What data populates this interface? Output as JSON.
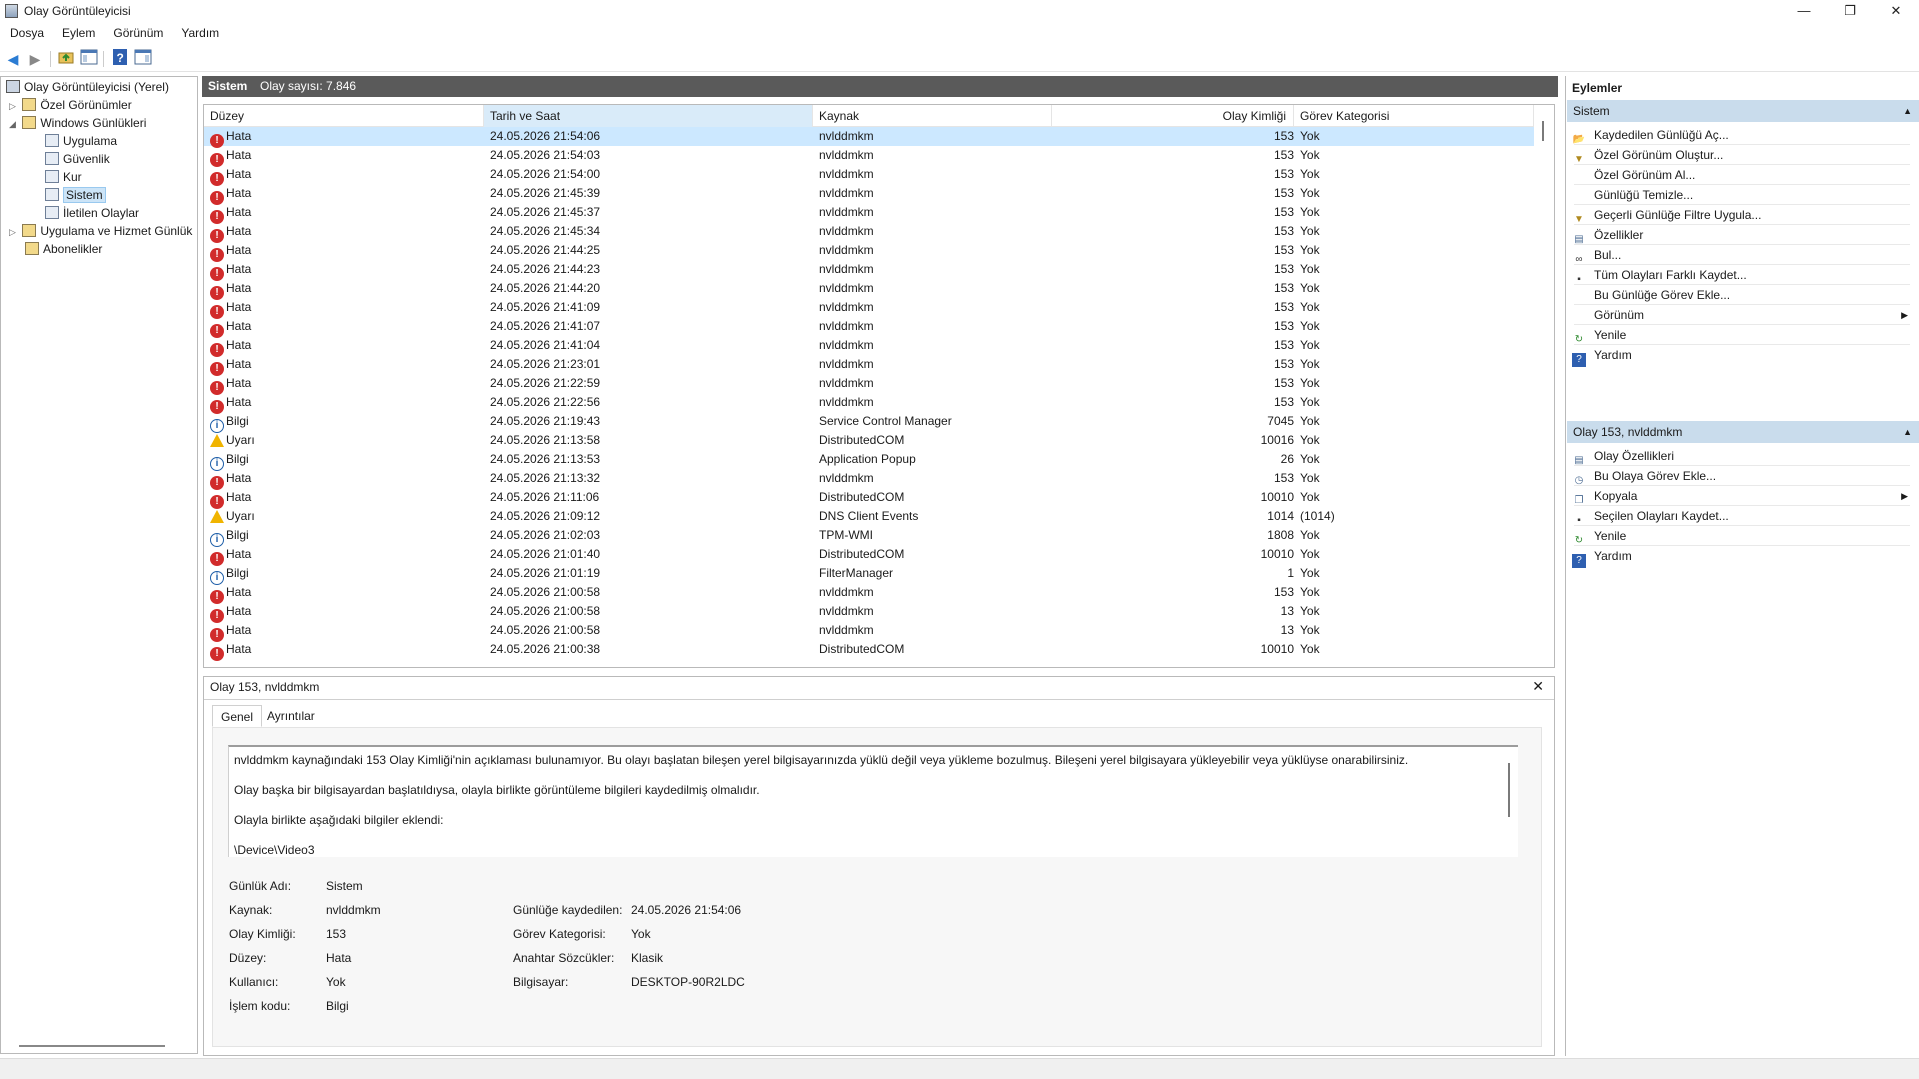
{
  "window": {
    "title": "Olay Görüntüleyicisi",
    "minimize": "—",
    "restore": "❐",
    "close": "✕"
  },
  "menu": [
    "Dosya",
    "Eylem",
    "Görünüm",
    "Yardım"
  ],
  "toolbar": {
    "icons": [
      "back-arrow-icon",
      "forward-arrow-icon",
      "folder-up-icon",
      "show-hide-tree-icon",
      "help-icon",
      "show-hide-action-pane-icon"
    ]
  },
  "tree": {
    "items": [
      {
        "label": "Olay Görüntüleyicisi (Yerel)",
        "icon": "computer-icon"
      },
      {
        "label": "Özel Görünümler",
        "icon": "folder-icon"
      },
      {
        "label": "Windows Günlükleri",
        "icon": "folder-icon"
      },
      {
        "label": "Uygulama",
        "icon": "log-icon"
      },
      {
        "label": "Güvenlik",
        "icon": "log-icon"
      },
      {
        "label": "Kur",
        "icon": "log-icon"
      },
      {
        "label": "Sistem",
        "icon": "log-icon"
      },
      {
        "label": "İletilen Olaylar",
        "icon": "log-icon"
      },
      {
        "label": "Uygulama ve Hizmet Günlük",
        "icon": "folder-icon"
      },
      {
        "label": "Abonelikler",
        "icon": "folder-icon"
      }
    ]
  },
  "header": {
    "log_name": "Sistem",
    "event_count": "Olay sayısı: 7.846"
  },
  "table": {
    "columns": [
      "Düzey",
      "Tarih ve Saat",
      "Kaynak",
      "Olay Kimliği",
      "Görev Kategorisi"
    ],
    "rows": [
      {
        "level": "Hata",
        "type": "error",
        "date": "24.05.2026 21:54:06",
        "source": "nvlddmkm",
        "id": "153",
        "category": "Yok"
      },
      {
        "level": "Hata",
        "type": "error",
        "date": "24.05.2026 21:54:03",
        "source": "nvlddmkm",
        "id": "153",
        "category": "Yok"
      },
      {
        "level": "Hata",
        "type": "error",
        "date": "24.05.2026 21:54:00",
        "source": "nvlddmkm",
        "id": "153",
        "category": "Yok"
      },
      {
        "level": "Hata",
        "type": "error",
        "date": "24.05.2026 21:45:39",
        "source": "nvlddmkm",
        "id": "153",
        "category": "Yok"
      },
      {
        "level": "Hata",
        "type": "error",
        "date": "24.05.2026 21:45:37",
        "source": "nvlddmkm",
        "id": "153",
        "category": "Yok"
      },
      {
        "level": "Hata",
        "type": "error",
        "date": "24.05.2026 21:45:34",
        "source": "nvlddmkm",
        "id": "153",
        "category": "Yok"
      },
      {
        "level": "Hata",
        "type": "error",
        "date": "24.05.2026 21:44:25",
        "source": "nvlddmkm",
        "id": "153",
        "category": "Yok"
      },
      {
        "level": "Hata",
        "type": "error",
        "date": "24.05.2026 21:44:23",
        "source": "nvlddmkm",
        "id": "153",
        "category": "Yok"
      },
      {
        "level": "Hata",
        "type": "error",
        "date": "24.05.2026 21:44:20",
        "source": "nvlddmkm",
        "id": "153",
        "category": "Yok"
      },
      {
        "level": "Hata",
        "type": "error",
        "date": "24.05.2026 21:41:09",
        "source": "nvlddmkm",
        "id": "153",
        "category": "Yok"
      },
      {
        "level": "Hata",
        "type": "error",
        "date": "24.05.2026 21:41:07",
        "source": "nvlddmkm",
        "id": "153",
        "category": "Yok"
      },
      {
        "level": "Hata",
        "type": "error",
        "date": "24.05.2026 21:41:04",
        "source": "nvlddmkm",
        "id": "153",
        "category": "Yok"
      },
      {
        "level": "Hata",
        "type": "error",
        "date": "24.05.2026 21:23:01",
        "source": "nvlddmkm",
        "id": "153",
        "category": "Yok"
      },
      {
        "level": "Hata",
        "type": "error",
        "date": "24.05.2026 21:22:59",
        "source": "nvlddmkm",
        "id": "153",
        "category": "Yok"
      },
      {
        "level": "Hata",
        "type": "error",
        "date": "24.05.2026 21:22:56",
        "source": "nvlddmkm",
        "id": "153",
        "category": "Yok"
      },
      {
        "level": "Bilgi",
        "type": "info",
        "date": "24.05.2026 21:19:43",
        "source": "Service Control Manager",
        "id": "7045",
        "category": "Yok"
      },
      {
        "level": "Uyarı",
        "type": "warning",
        "date": "24.05.2026 21:13:58",
        "source": "DistributedCOM",
        "id": "10016",
        "category": "Yok"
      },
      {
        "level": "Bilgi",
        "type": "info",
        "date": "24.05.2026 21:13:53",
        "source": "Application Popup",
        "id": "26",
        "category": "Yok"
      },
      {
        "level": "Hata",
        "type": "error",
        "date": "24.05.2026 21:13:32",
        "source": "nvlddmkm",
        "id": "153",
        "category": "Yok"
      },
      {
        "level": "Hata",
        "type": "error",
        "date": "24.05.2026 21:11:06",
        "source": "DistributedCOM",
        "id": "10010",
        "category": "Yok"
      },
      {
        "level": "Uyarı",
        "type": "warning",
        "date": "24.05.2026 21:09:12",
        "source": "DNS Client Events",
        "id": "1014",
        "category": "(1014)"
      },
      {
        "level": "Bilgi",
        "type": "info",
        "date": "24.05.2026 21:02:03",
        "source": "TPM-WMI",
        "id": "1808",
        "category": "Yok"
      },
      {
        "level": "Hata",
        "type": "error",
        "date": "24.05.2026 21:01:40",
        "source": "DistributedCOM",
        "id": "10010",
        "category": "Yok"
      },
      {
        "level": "Bilgi",
        "type": "info",
        "date": "24.05.2026 21:01:19",
        "source": "FilterManager",
        "id": "1",
        "category": "Yok"
      },
      {
        "level": "Hata",
        "type": "error",
        "date": "24.05.2026 21:00:58",
        "source": "nvlddmkm",
        "id": "153",
        "category": "Yok"
      },
      {
        "level": "Hata",
        "type": "error",
        "date": "24.05.2026 21:00:58",
        "source": "nvlddmkm",
        "id": "13",
        "category": "Yok"
      },
      {
        "level": "Hata",
        "type": "error",
        "date": "24.05.2026 21:00:58",
        "source": "nvlddmkm",
        "id": "13",
        "category": "Yok"
      },
      {
        "level": "Hata",
        "type": "error",
        "date": "24.05.2026 21:00:38",
        "source": "DistributedCOM",
        "id": "10010",
        "category": "Yok"
      }
    ]
  },
  "detail": {
    "title": "Olay 153, nvlddmkm",
    "close": "✕",
    "tabs": [
      "Genel",
      "Ayrıntılar"
    ],
    "description": [
      "nvlddmkm kaynağındaki 153 Olay Kimliği'nin açıklaması bulunamıyor. Bu olayı başlatan bileşen yerel bilgisayarınızda yüklü değil veya yükleme bozulmuş. Bileşeni yerel bilgisayara yükleyebilir veya yüklüyse onarabilirsiniz.",
      "Olay başka bir bilgisayardan başlatıldıysa, olayla birlikte görüntüleme bilgileri kaydedilmiş olmalıdır.",
      "Olayla birlikte aşağıdaki bilgiler eklendi:",
      "\\Device\\Video3"
    ],
    "fields": {
      "log_name_label": "Günlük Adı:",
      "log_name": "Sistem",
      "source_label": "Kaynak:",
      "source": "nvlddmkm",
      "logged_label": "Günlüğe kaydedilen:",
      "logged": "24.05.2026 21:54:06",
      "event_id_label": "Olay Kimliği:",
      "event_id": "153",
      "task_label": "Görev Kategorisi:",
      "task": "Yok",
      "level_label": "Düzey:",
      "level": "Hata",
      "keywords_label": "Anahtar Sözcükler:",
      "keywords": "Klasik",
      "user_label": "Kullanıcı:",
      "user": "Yok",
      "computer_label": "Bilgisayar:",
      "computer": "DESKTOP-90R2LDC",
      "opcode_label": "İşlem kodu:",
      "opcode": "Bilgi"
    }
  },
  "actions": {
    "title": "Eylemler",
    "section1": {
      "title": "Sistem",
      "items": [
        {
          "label": "Kaydedilen Günlüğü Aç...",
          "icon": "open-folder-icon"
        },
        {
          "label": "Özel Görünüm Oluştur...",
          "icon": "filter-icon"
        },
        {
          "label": "Özel Görünüm Al...",
          "icon": ""
        },
        {
          "label": "Günlüğü Temizle...",
          "icon": ""
        },
        {
          "label": "Geçerli Günlüğe Filtre Uygula...",
          "icon": "filter-icon"
        },
        {
          "label": "Özellikler",
          "icon": "properties-icon"
        },
        {
          "label": "Bul...",
          "icon": "binoculars-icon"
        },
        {
          "label": "Tüm Olayları Farklı Kaydet...",
          "icon": "save-icon"
        },
        {
          "label": "Bu Günlüğe Görev Ekle...",
          "icon": ""
        },
        {
          "label": "Görünüm",
          "icon": "",
          "submenu": true
        },
        {
          "label": "Yenile",
          "icon": "refresh-icon"
        },
        {
          "label": "Yardım",
          "icon": "help-icon"
        }
      ]
    },
    "section2": {
      "title": "Olay 153, nvlddmkm",
      "items": [
        {
          "label": "Olay Özellikleri",
          "icon": "event-properties-icon"
        },
        {
          "label": "Bu Olaya Görev Ekle...",
          "icon": "task-icon"
        },
        {
          "label": "Kopyala",
          "icon": "copy-icon",
          "submenu": true
        },
        {
          "label": "Seçilen Olayları Kaydet...",
          "icon": "save-icon"
        },
        {
          "label": "Yenile",
          "icon": "refresh-icon"
        },
        {
          "label": "Yardım",
          "icon": "help-icon"
        }
      ]
    }
  }
}
